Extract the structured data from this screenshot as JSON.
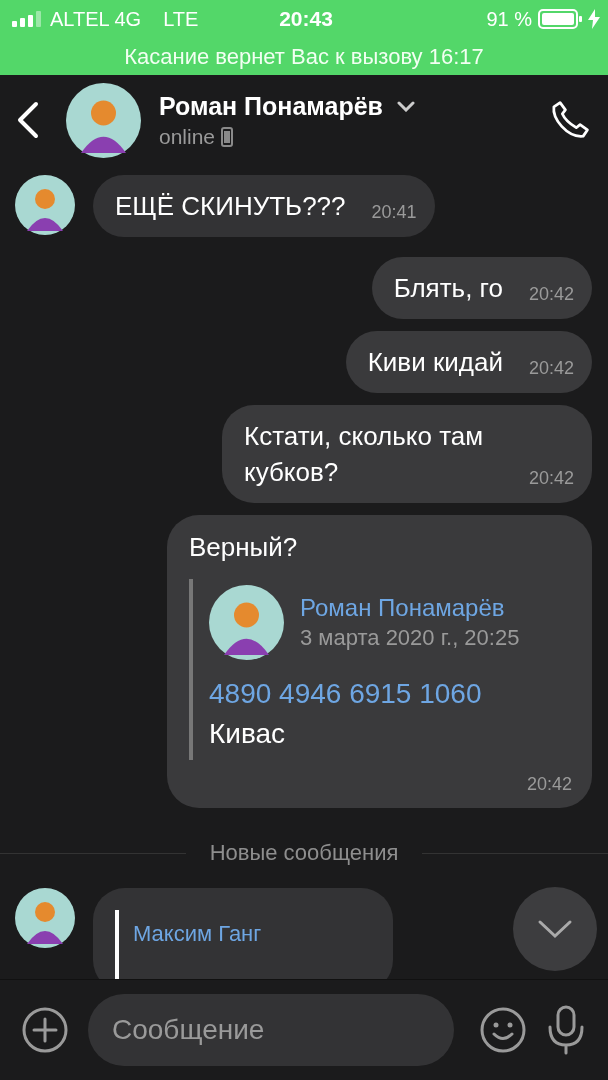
{
  "status_bar": {
    "carrier": "ALTEL 4G",
    "network": "LTE",
    "time": "20:43",
    "battery": "91 %"
  },
  "call_banner": {
    "text": "Касание вернет Вас к вызову 16:17"
  },
  "header": {
    "name": "Роман Понамарёв",
    "status": "online"
  },
  "messages": [
    {
      "kind": "incoming",
      "text": "ЕЩЁ СКИНУТЬ???",
      "time": "20:41"
    },
    {
      "kind": "outgoing",
      "text": "Блять, го",
      "time": "20:42"
    },
    {
      "kind": "outgoing",
      "text": "Киви кидай",
      "time": "20:42"
    },
    {
      "kind": "outgoing",
      "text": "Кстати, сколько там кубков?",
      "time": "20:42"
    },
    {
      "kind": "outgoing",
      "text": "Верный?",
      "time": "20:42",
      "forward": {
        "author": "Роман Понамарёв",
        "date": "3 марта 2020 г., 20:25",
        "link": "4890 4946 6915 1060",
        "text": "Кивас"
      }
    },
    {
      "kind": "divider",
      "text": "Новые сообщения"
    },
    {
      "kind": "incoming",
      "reply": {
        "author": "Максим Ганг"
      }
    }
  ],
  "composer": {
    "placeholder": "Сообщение"
  }
}
